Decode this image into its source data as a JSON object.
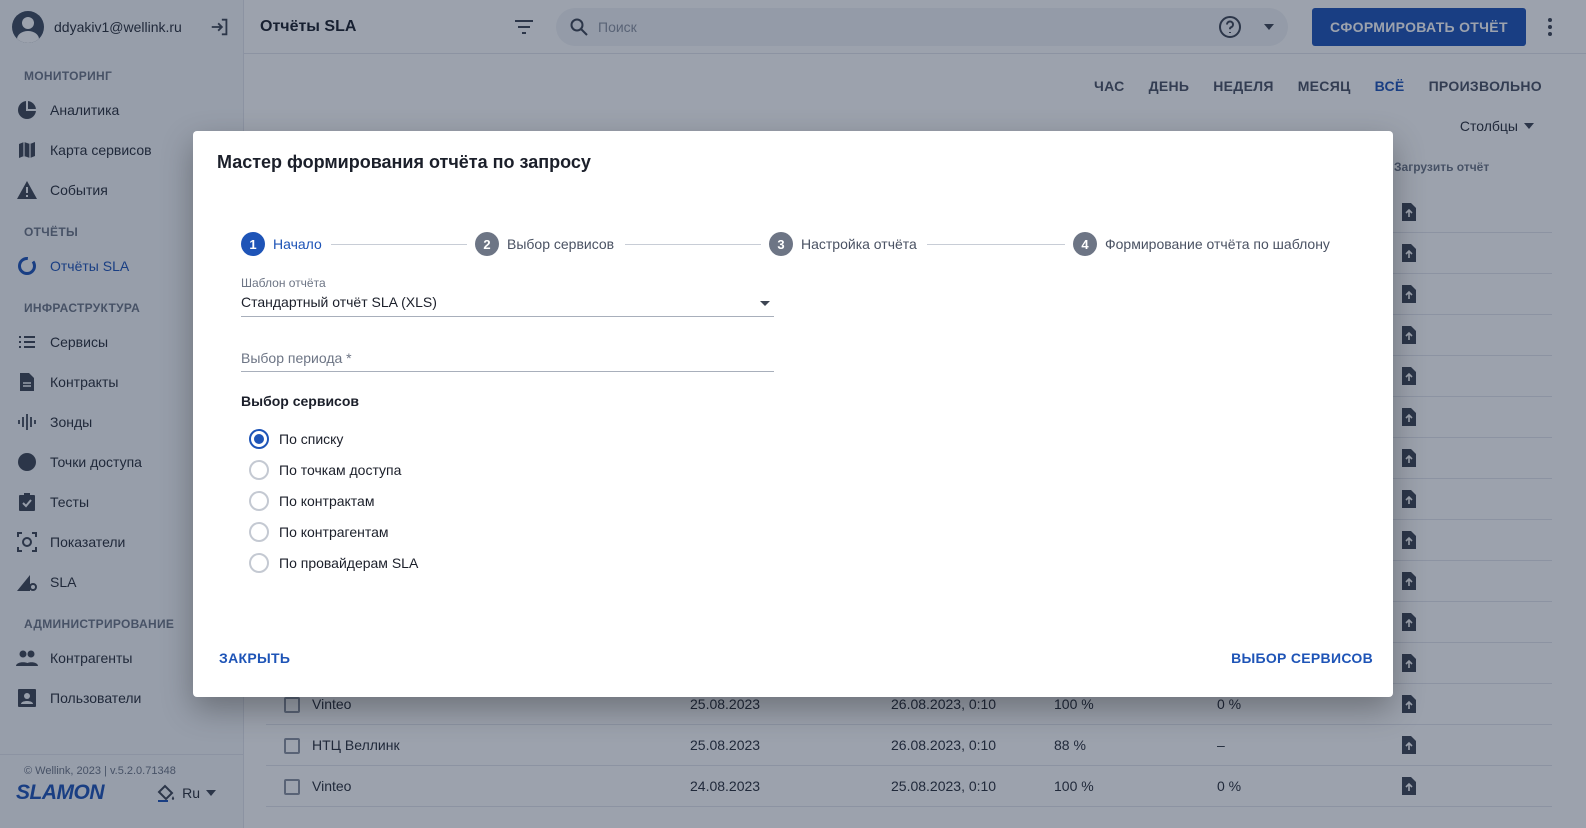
{
  "user": {
    "email": "ddyakiv1@wellink.ru"
  },
  "sidebar": {
    "sections": [
      {
        "title": "МОНИТОРИНГ",
        "items": [
          {
            "label": "Аналитика",
            "icon": "pie-chart-icon"
          },
          {
            "label": "Карта сервисов",
            "icon": "map-icon"
          },
          {
            "label": "События",
            "icon": "warning-icon"
          }
        ]
      },
      {
        "title": "ОТЧЁТЫ",
        "items": [
          {
            "label": "Отчёты SLA",
            "icon": "report-sla-icon",
            "active": true
          }
        ]
      },
      {
        "title": "ИНФРАСТРУКТУРА",
        "items": [
          {
            "label": "Сервисы",
            "icon": "list-icon"
          },
          {
            "label": "Контракты",
            "icon": "document-icon"
          },
          {
            "label": "Зонды",
            "icon": "probe-icon"
          },
          {
            "label": "Точки доступа",
            "icon": "access-point-icon"
          },
          {
            "label": "Тесты",
            "icon": "checklist-icon"
          },
          {
            "label": "Показатели",
            "icon": "metrics-icon"
          },
          {
            "label": "SLA",
            "icon": "sla-icon"
          }
        ]
      },
      {
        "title": "АДМИНИСТРИРОВАНИЕ",
        "items": [
          {
            "label": "Контрагенты",
            "icon": "people-icon"
          },
          {
            "label": "Пользователи",
            "icon": "user-badge-icon"
          }
        ]
      }
    ],
    "footer": {
      "copyright": "© Wellink, 2023 | v.5.2.0.71348",
      "logo": "SLAMON",
      "language": "Ru"
    }
  },
  "topbar": {
    "title": "Отчёты SLA",
    "search_placeholder": "Поиск",
    "primary_button": "СФОРМИРОВАТЬ ОТЧЁТ"
  },
  "period_tabs": {
    "items": [
      "ЧАС",
      "ДЕНЬ",
      "НЕДЕЛЯ",
      "МЕСЯЦ",
      "ВСЁ",
      "ПРОИЗВОЛЬНО"
    ],
    "active": "ВСЁ"
  },
  "columns_button": "Столбцы",
  "table": {
    "download_header": "Загрузить отчёт",
    "visible_rows": [
      {
        "name": "Vinteo",
        "date": "25.08.2023",
        "created": "26.08.2023, 0:10",
        "availability": "100 %",
        "violations": "0 %"
      },
      {
        "name": "НТЦ Веллинк",
        "date": "25.08.2023",
        "created": "26.08.2023, 0:10",
        "availability": "88 %",
        "violations": "–"
      },
      {
        "name": "Vinteo",
        "date": "24.08.2023",
        "created": "25.08.2023, 0:10",
        "availability": "100 %",
        "violations": "0 %"
      }
    ]
  },
  "dialog": {
    "title": "Мастер формирования отчёта по запросу",
    "steps": [
      {
        "num": "1",
        "label": "Начало",
        "active": true
      },
      {
        "num": "2",
        "label": "Выбор сервисов"
      },
      {
        "num": "3",
        "label": "Настройка отчёта"
      },
      {
        "num": "4",
        "label": "Формирование отчёта по шаблону"
      }
    ],
    "template_field": {
      "label": "Шаблон отчёта",
      "value": "Стандартный отчёт SLA (XLS)"
    },
    "period_field": {
      "placeholder": "Выбор периода *"
    },
    "services_title": "Выбор сервисов",
    "radio_options": [
      "По списку",
      "По точкам доступа",
      "По контрактам",
      "По контрагентам",
      "По провайдерам SLA"
    ],
    "radio_selected": "По списку",
    "close_button": "ЗАКРЫТЬ",
    "next_button": "ВЫБОР СЕРВИСОВ"
  },
  "colors": {
    "accent": "#1e54b7",
    "overlay": "rgba(20,34,60,0.42)"
  }
}
